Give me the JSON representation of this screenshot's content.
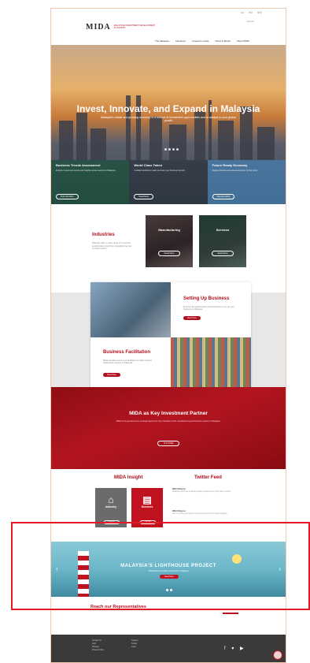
{
  "topbar": {
    "items": [
      "EN",
      "BM",
      "中文"
    ]
  },
  "header": {
    "logo": "MIDA",
    "logo_sub": "MALAYSIAN INVESTMENT DEVELOPMENT AUTHORITY",
    "right_text": "Search"
  },
  "nav": {
    "items": [
      "The Malaysia",
      "Industries",
      "Investor's Guide",
      "News & Media",
      "About MIDA"
    ]
  },
  "hero": {
    "title": "Invest, Innovate, and Expand in Malaysia",
    "subtitle": "Malaysia's stable and growing economy is a hotbed of investment opportunities and a catalyst to your global growth",
    "cards": [
      {
        "title": "Business Trends Assessment",
        "desc": "Explore investment trends and insights across sectors in Malaysia",
        "button": "Find Out More"
      },
      {
        "title": "World Class Talent",
        "desc": "A skilled workforce ready to power your business growth",
        "button": "Read More"
      },
      {
        "title": "Future Ready Economy",
        "desc": "Digital infrastructure and connectivity for the future",
        "button": "Discover More"
      }
    ]
  },
  "industries": {
    "title": "Industries",
    "text": "Malaysia offers a wide range of investment opportunities in both the manufacturing and services sectors.",
    "tiles": [
      {
        "label": "Manufacturing",
        "button": "Read More"
      },
      {
        "label": "Services",
        "button": "Read More"
      }
    ]
  },
  "business": {
    "setup_title": "Setting Up Business",
    "setup_text": "Find out the requirements and procedures to set up your business in Malaysia.",
    "setup_button": "Read More",
    "facil_title": "Business Facilitation",
    "facil_text": "MIDA provides end-to-end facilitation to help investors realise their projects in Malaysia.",
    "facil_button": "Read More"
  },
  "partner": {
    "title": "MIDA as Key Investment Partner",
    "text": "MIDA is the government's principal agency for the promotion of the manufacturing and services sectors in Malaysia.",
    "button": "Our Profile"
  },
  "insight": {
    "title": "MIDA Insight",
    "tiles": [
      {
        "label": "Industry",
        "icon": "factory-icon",
        "button": "Read"
      },
      {
        "label": "Services",
        "icon": "document-icon",
        "button": "Read"
      }
    ]
  },
  "twitter": {
    "title": "Twitter Feed",
    "tweets": [
      {
        "handle": "MIDA Malaysia",
        "text": "Malaysia continues to attract quality investments in high value sectors."
      },
      {
        "handle": "MIDA Malaysia",
        "text": "Join us at the upcoming investment seminar for the latest updates."
      }
    ]
  },
  "banner": {
    "title": "MALAYSIA'S LIGHTHOUSE PROJECT",
    "subtitle": "Showcasing exemplary investments in Malaysia",
    "button": "Read More"
  },
  "reach": {
    "title": "Reach our Representatives"
  },
  "footer": {
    "col1": [
      "Contact Us",
      "FAQ",
      "Sitemap",
      "Privacy Policy"
    ],
    "col2": [
      "Careers",
      "Tender",
      "Links"
    ],
    "social": "f ▾ ▶"
  },
  "colors": {
    "brand_red": "#b10f1d",
    "highlight": "#e01b24",
    "footer": "#3a3a3a"
  }
}
